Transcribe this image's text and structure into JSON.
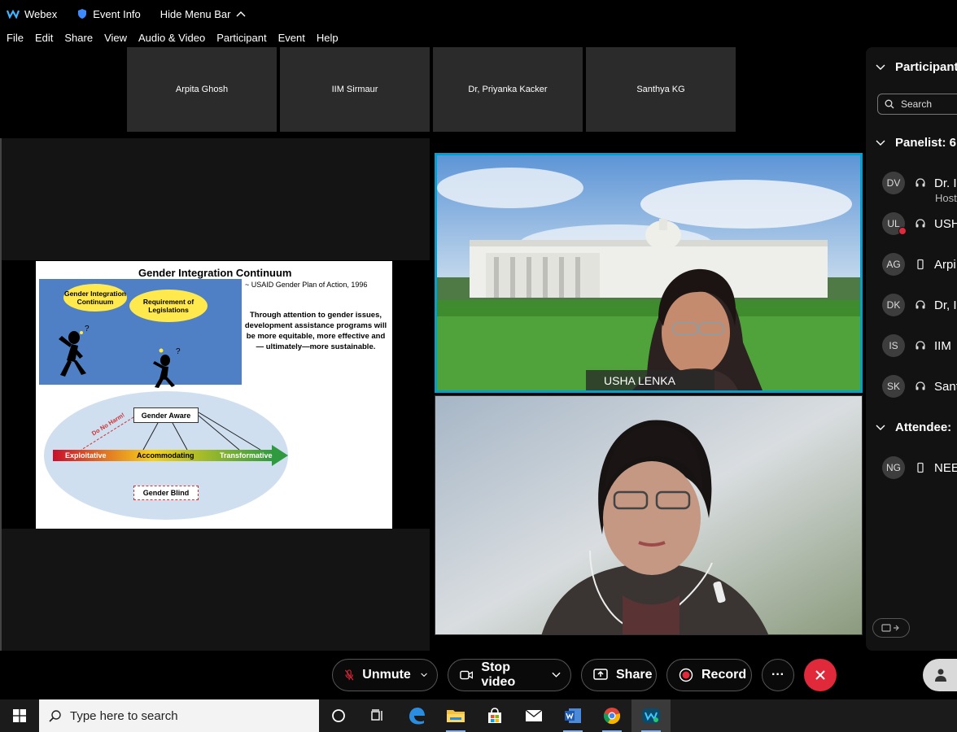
{
  "titlebar": {
    "app_name": "Webex",
    "event_info": "Event Info",
    "hide_menu": "Hide Menu Bar"
  },
  "menu": [
    "File",
    "Edit",
    "Share",
    "View",
    "Audio & Video",
    "Participant",
    "Event",
    "Help"
  ],
  "filmstrip": [
    "Arpita Ghosh",
    "IIM Sirmaur",
    "Dr, Priyanka Kacker",
    "Santhya KG"
  ],
  "slide": {
    "title": "Gender Integration Continuum",
    "source": "~ USAID Gender Plan of Action, 1996",
    "cloud1": "Gender Integration Continuum",
    "cloud2": "Requirement of Legislations",
    "body": "Through attention to gender issues, development assistance programs will be more equitable, more effective and— ultimately—more sustainable.",
    "gender_aware": "Gender Aware",
    "do_no_harm": "Do No Harm!",
    "exploitative": "Exploitative",
    "accommodating": "Accommodating",
    "transformative": "Transformative",
    "gender_blind": "Gender Blind"
  },
  "video": {
    "speaker_name": "USHA LENKA"
  },
  "panel": {
    "title": "Participant",
    "search_placeholder": "Search",
    "panelist_header": "Panelist: 6",
    "attendee_header": "Attendee:",
    "panelists": [
      {
        "initials": "DV",
        "name": "Dr. I",
        "role": "Host"
      },
      {
        "initials": "UL",
        "name": "USH"
      },
      {
        "initials": "AG",
        "name": "Arpi"
      },
      {
        "initials": "DK",
        "name": "Dr, I"
      },
      {
        "initials": "IS",
        "name": "IIM"
      },
      {
        "initials": "SK",
        "name": "Sant"
      }
    ],
    "attendees": [
      {
        "initials": "NG",
        "name": "NEE"
      }
    ]
  },
  "controls": {
    "unmute": "Unmute",
    "stop_video": "Stop video",
    "share": "Share",
    "record": "Record",
    "more": "···"
  },
  "taskbar": {
    "search_placeholder": "Type here to search"
  },
  "colors": {
    "accent": "#00a0d1",
    "end_call": "#e0293a",
    "panel_bg": "#121212"
  }
}
